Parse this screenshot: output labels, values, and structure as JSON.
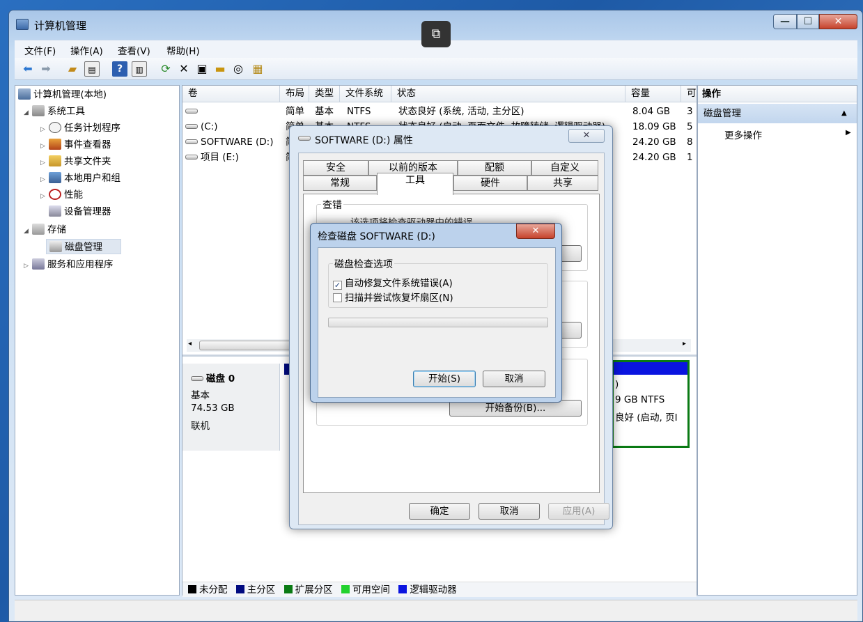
{
  "window": {
    "title": "计算机管理",
    "min_glyph": "—",
    "max_glyph": "☐",
    "close_glyph": "✕"
  },
  "menu": [
    "文件(F)",
    "操作(A)",
    "查看(V)",
    "帮助(H)"
  ],
  "toolbar_icons": [
    "back-arrow-icon",
    "forward-arrow-icon",
    "up-folder-icon",
    "show-hide-tree-icon",
    "help-icon",
    "show-hide-action-pane-icon",
    "refresh-icon",
    "delete-icon",
    "properties-icon",
    "open-folder-icon",
    "search-disk-icon",
    "export-icon"
  ],
  "tree": {
    "root": "计算机管理(本地)",
    "system_tools": "系统工具",
    "task_scheduler": "任务计划程序",
    "event_viewer": "事件查看器",
    "shared_folders": "共享文件夹",
    "local_users": "本地用户和组",
    "performance": "性能",
    "device_manager": "设备管理器",
    "storage": "存储",
    "disk_management": "磁盘管理",
    "services_apps": "服务和应用程序"
  },
  "volumes": {
    "headers": [
      "卷",
      "布局",
      "类型",
      "文件系统",
      "状态",
      "容量",
      "可"
    ],
    "rows": [
      {
        "name": "",
        "layout": "简单",
        "type": "基本",
        "fs": "NTFS",
        "status": "状态良好 (系统, 活动, 主分区)",
        "capacity": "8.04 GB",
        "free": "3"
      },
      {
        "name": "(C:)",
        "layout": "简单",
        "type": "基本",
        "fs": "NTFS",
        "status": "状态良好 (启动, 页面文件, 故障转储, 逻辑驱动器)",
        "capacity": "18.09 GB",
        "free": "5"
      },
      {
        "name": "SOFTWARE (D:)",
        "layout": "简",
        "type": "",
        "fs": "",
        "status": "",
        "capacity": "24.20 GB",
        "free": "8"
      },
      {
        "name": "项目 (E:)",
        "layout": "简",
        "type": "",
        "fs": "",
        "status": "",
        "capacity": "24.20 GB",
        "free": "1"
      }
    ]
  },
  "disk0": {
    "name": "磁盘 0",
    "type": "基本",
    "size": "74.53 GB",
    "state": "联机",
    "partial_fs": "9 GB NTFS",
    "partial_status": "良好 (启动, 页I",
    "partial_paren": ")"
  },
  "legend": [
    {
      "label": "未分配",
      "color": "#000000"
    },
    {
      "label": "主分区",
      "color": "#000a80"
    },
    {
      "label": "扩展分区",
      "color": "#0a7a14"
    },
    {
      "label": "可用空间",
      "color": "#22d22e"
    },
    {
      "label": "逻辑驱动器",
      "color": "#0a14e0"
    }
  ],
  "actions": {
    "header": "操作",
    "section": "磁盘管理",
    "more": "更多操作"
  },
  "props": {
    "title": "SOFTWARE (D:) 属性",
    "tabs_row1": [
      "安全",
      "以前的版本",
      "配额",
      "自定义"
    ],
    "tabs_row2": [
      "常规",
      "工具",
      "硬件",
      "共享"
    ],
    "group_error": "查错",
    "error_desc": "该选项将检查驱动器中的错误。",
    "backup_button": "开始备份(B)...",
    "ok": "确定",
    "cancel": "取消",
    "apply": "应用(A)",
    "close_glyph": "✕"
  },
  "chkdsk": {
    "title": "检查磁盘 SOFTWARE (D:)",
    "group": "磁盘检查选项",
    "opt1": "自动修复文件系统错误(A)",
    "opt2": "扫描并尝试恢复坏扇区(N)",
    "opt1_checked": true,
    "opt2_checked": false,
    "start": "开始(S)",
    "cancel": "取消",
    "close_glyph": "✕"
  },
  "overlay": {
    "restore_glyph": "⧉"
  }
}
